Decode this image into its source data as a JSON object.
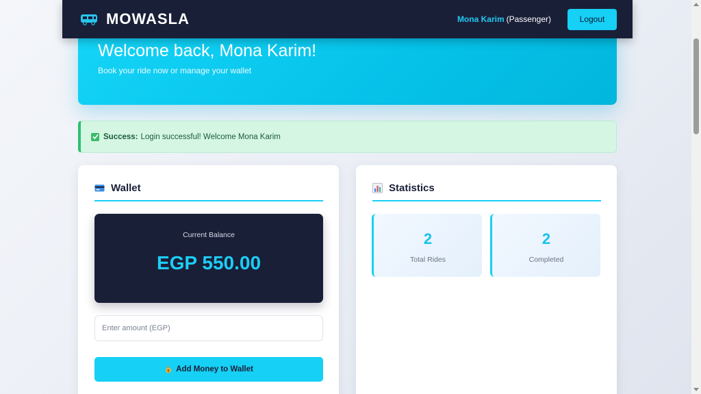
{
  "app": {
    "brand": "MOWASLA"
  },
  "navbar": {
    "user_name": "Mona Karim",
    "user_role": "(Passenger)",
    "logout_label": "Logout"
  },
  "hero": {
    "title": "Welcome back, Mona Karim!",
    "subtitle": "Book your ride now or manage your wallet"
  },
  "alert": {
    "strong": "Success:",
    "message": "Login successful! Welcome Mona Karim"
  },
  "wallet": {
    "title": "Wallet",
    "icon": "credit-card-icon",
    "balance_label": "Current Balance",
    "balance_value": "EGP 550.00",
    "amount_placeholder": "Enter amount (EGP)",
    "add_button_label": "Add Money to Wallet",
    "add_button_icon": "money-bag-icon"
  },
  "stats": {
    "title": "Statistics",
    "icon": "bar-chart-icon",
    "tiles": [
      {
        "value": "2",
        "label": "Total Rides"
      },
      {
        "value": "2",
        "label": "Completed"
      }
    ]
  },
  "colors": {
    "accent": "#16d0f5",
    "navy": "#1a1f38",
    "success": "#2fbf71"
  }
}
